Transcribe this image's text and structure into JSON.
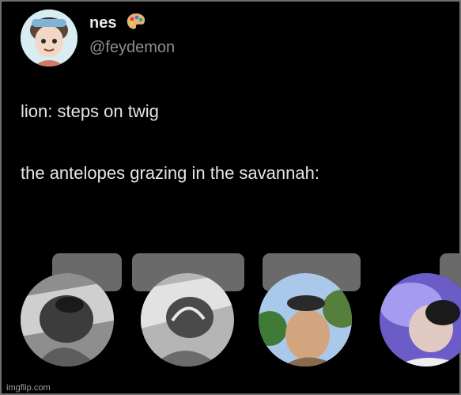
{
  "tweet": {
    "author_name": "nes",
    "author_handle": "@feydemon",
    "text_line_1": "lion: steps on twig",
    "text_line_2": "the antelopes grazing in the savannah:"
  },
  "reaction_circles": [
    {
      "icon": "grayscale-face-photo"
    },
    {
      "icon": "grayscale-face-photo"
    },
    {
      "icon": "color-face-photo-trees"
    },
    {
      "icon": "color-face-photo-purple"
    }
  ],
  "watermark": "imgflip.com",
  "colors": {
    "background": "#000000",
    "primary_text": "#e6e6e6",
    "secondary_text": "#8b8f94",
    "redaction": "#6a6a6a"
  }
}
